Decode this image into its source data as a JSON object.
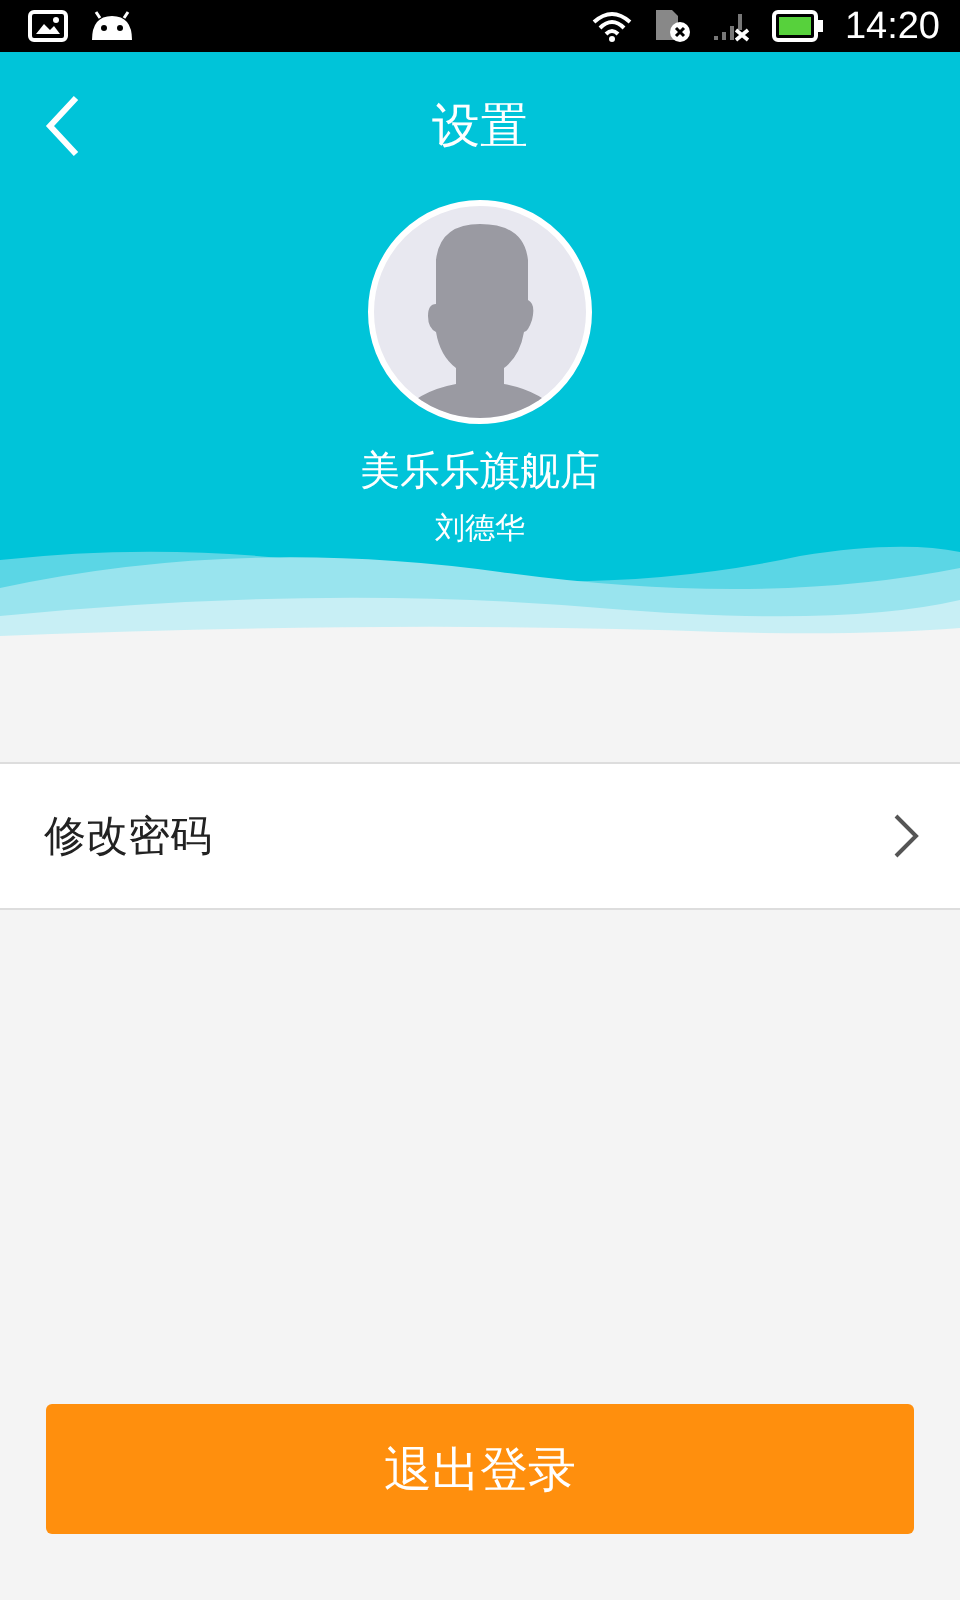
{
  "status_bar": {
    "time": "14:20"
  },
  "header": {
    "title": "设置"
  },
  "profile": {
    "store_name": "美乐乐旗舰店",
    "user_name": "刘德华"
  },
  "menu_items": [
    {
      "label": "修改密码"
    }
  ],
  "logout_button": {
    "label": "退出登录"
  }
}
